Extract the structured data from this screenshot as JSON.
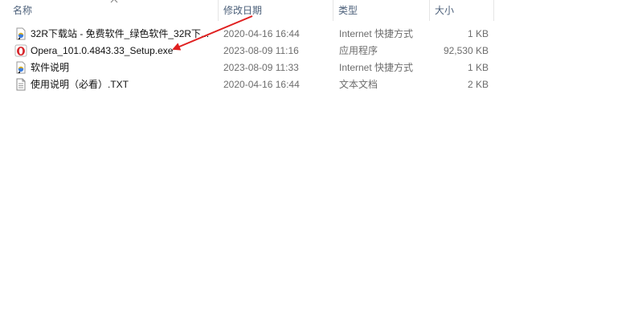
{
  "header": {
    "name_label": "名称",
    "date_label": "修改日期",
    "type_label": "类型",
    "size_label": "大小"
  },
  "files": [
    {
      "name": "32R下载站 - 免费软件_绿色软件_32R下...",
      "date": "2020-04-16 16:44",
      "type": "Internet 快捷方式",
      "size": "1 KB",
      "icon": "internet-shortcut-icon"
    },
    {
      "name": "Opera_101.0.4843.33_Setup.exe",
      "date": "2023-08-09 11:16",
      "type": "应用程序",
      "size": "92,530 KB",
      "icon": "opera-installer-icon"
    },
    {
      "name": "软件说明",
      "date": "2023-08-09 11:33",
      "type": "Internet 快捷方式",
      "size": "1 KB",
      "icon": "internet-shortcut-icon"
    },
    {
      "name": "使用说明（必看）.TXT",
      "date": "2020-04-16 16:44",
      "type": "文本文档",
      "size": "2 KB",
      "icon": "text-document-icon"
    }
  ],
  "colors": {
    "header_text": "#4c607a",
    "secondary_text": "#6d6d6d",
    "arrow": "#e02020",
    "opera_red": "#d7262c"
  }
}
